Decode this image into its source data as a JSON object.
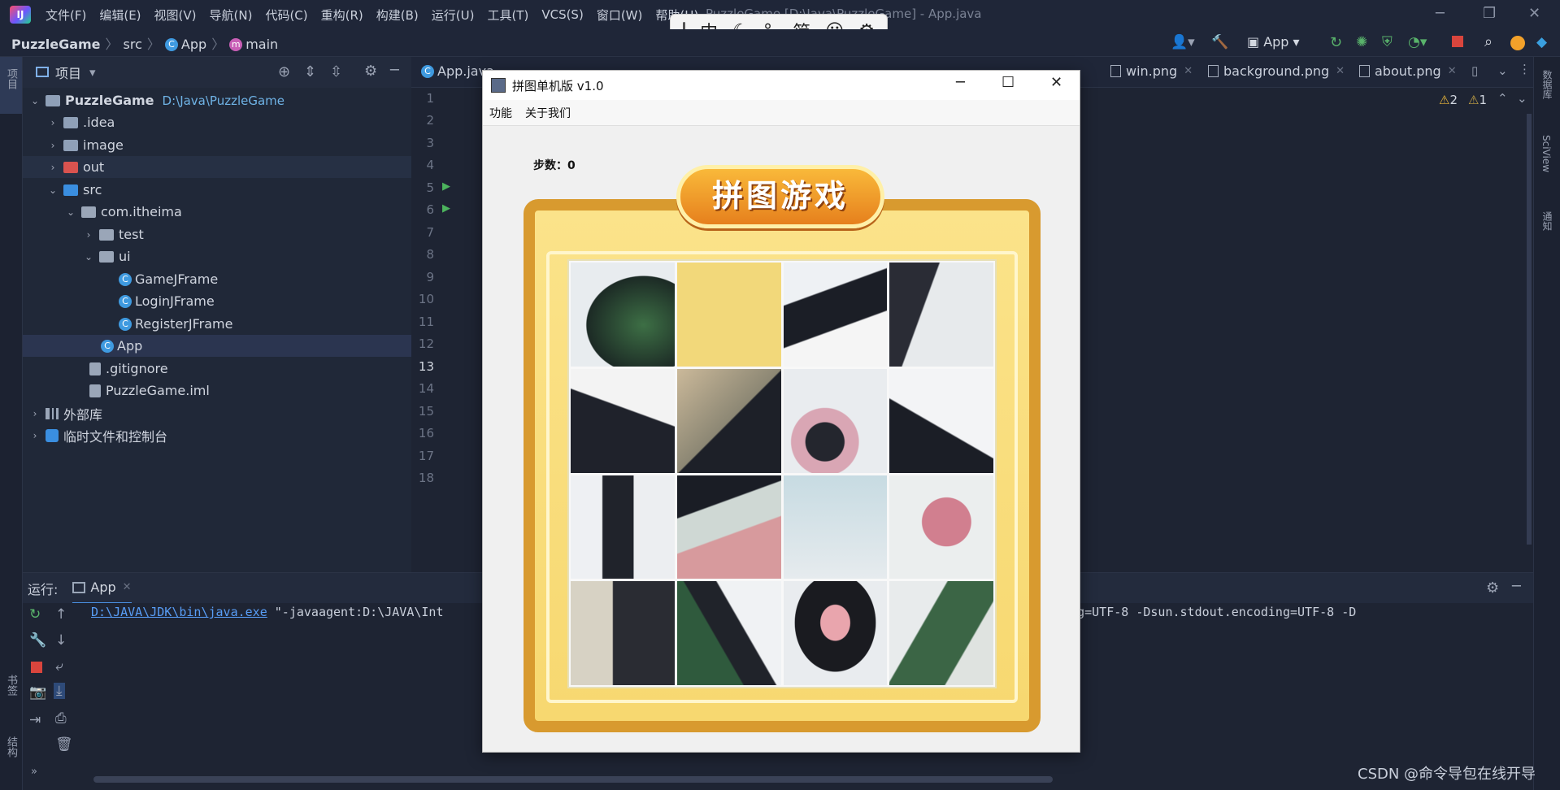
{
  "ide": {
    "menu": [
      "文件(F)",
      "编辑(E)",
      "视图(V)",
      "导航(N)",
      "代码(C)",
      "重构(R)",
      "构建(B)",
      "运行(U)",
      "工具(T)",
      "VCS(S)",
      "窗口(W)",
      "帮助(H)"
    ],
    "window_title": "PuzzleGame [D:\\Java\\PuzzleGame] - App.java",
    "ime": [
      "中",
      "☾",
      "°,",
      "简",
      "☺",
      "⚙"
    ],
    "breadcrumb": {
      "project": "PuzzleGame",
      "folder": "src",
      "class": "App",
      "method": "main"
    },
    "run_config": "App",
    "left_strip": {
      "project": "项目",
      "bookmarks": "书签",
      "structure": "结构"
    },
    "right_strip": {
      "database": "数据库",
      "sciview": "SciView",
      "notifications": "通知"
    }
  },
  "project_panel": {
    "title": "项目",
    "tree": [
      {
        "label": "PuzzleGame",
        "path": "D:\\Java\\PuzzleGame"
      },
      {
        "label": ".idea"
      },
      {
        "label": "image"
      },
      {
        "label": "out"
      },
      {
        "label": "src"
      },
      {
        "label": "com.itheima"
      },
      {
        "label": "test"
      },
      {
        "label": "ui"
      },
      {
        "label": "GameJFrame"
      },
      {
        "label": "LoginJFrame"
      },
      {
        "label": "RegisterJFrame"
      },
      {
        "label": "App"
      },
      {
        "label": ".gitignore"
      },
      {
        "label": "PuzzleGame.iml"
      },
      {
        "label": "外部库"
      },
      {
        "label": "临时文件和控制台"
      }
    ]
  },
  "editor": {
    "tabs": [
      "App.java",
      "win.png",
      "background.png",
      "about.png"
    ],
    "line_numbers": [
      "1",
      "2",
      "3",
      "4",
      "5",
      "6",
      "7",
      "8",
      "9",
      "10",
      "11",
      "12",
      "13",
      "14",
      "15",
      "16",
      "17",
      "18"
    ],
    "current_line": "13",
    "warnings": "2",
    "weak_warnings": "1"
  },
  "run_panel": {
    "label": "运行:",
    "tab": "App",
    "java_path": "D:\\JAVA\\JDK\\bin\\java.exe",
    "args_start": " \"-javaagent:D:\\JAVA\\Int",
    "args_end": "bin\" -Dfile.encoding=UTF-8 -Dsun.stdout.encoding=UTF-8 -D"
  },
  "game_window": {
    "title": "拼图单机版 v1.0",
    "menu": [
      "功能",
      "关于我们"
    ],
    "steps_label": "步数：",
    "steps_value": "0",
    "logo_text": "拼图游戏",
    "tiles": [
      1,
      0,
      2,
      3,
      4,
      5,
      6,
      7,
      8,
      9,
      10,
      11,
      12,
      13,
      14,
      15
    ]
  },
  "watermark": "CSDN @命令导包在线开导"
}
